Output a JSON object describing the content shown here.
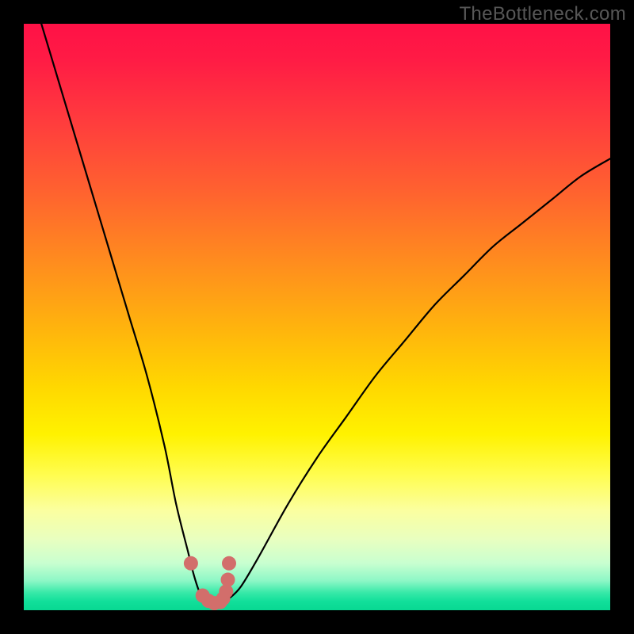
{
  "watermark": "TheBottleneck.com",
  "colors": {
    "frame": "#000000",
    "curve_stroke": "#000000",
    "marker_fill": "#d26e6b",
    "gradient_top": "#ff1146",
    "gradient_bottom": "#08d892"
  },
  "chart_data": {
    "type": "line",
    "title": "",
    "xlabel": "",
    "ylabel": "",
    "xlim": [
      0,
      100
    ],
    "ylim": [
      0,
      100
    ],
    "grid": false,
    "legend": false,
    "series": [
      {
        "name": "bottleneck-curve",
        "x": [
          3,
          6,
          9,
          12,
          15,
          18,
          21,
          24,
          26,
          28,
          29,
          30,
          31,
          32,
          33,
          34,
          35,
          37,
          40,
          45,
          50,
          55,
          60,
          65,
          70,
          75,
          80,
          85,
          90,
          95,
          100
        ],
        "y": [
          100,
          90,
          80,
          70,
          60,
          50,
          40,
          28,
          18,
          10,
          6,
          3,
          1.5,
          1,
          1,
          1.5,
          2,
          4,
          9,
          18,
          26,
          33,
          40,
          46,
          52,
          57,
          62,
          66,
          70,
          74,
          77
        ]
      }
    ],
    "markers": {
      "name": "highlight-points",
      "x": [
        28.5,
        30.5,
        31.5,
        32.5,
        33.5,
        34.0,
        34.5,
        34.8,
        35.0
      ],
      "y": [
        8.0,
        2.5,
        1.6,
        1.2,
        1.4,
        2.0,
        3.2,
        5.2,
        8.0
      ],
      "radius_px": 9
    }
  }
}
